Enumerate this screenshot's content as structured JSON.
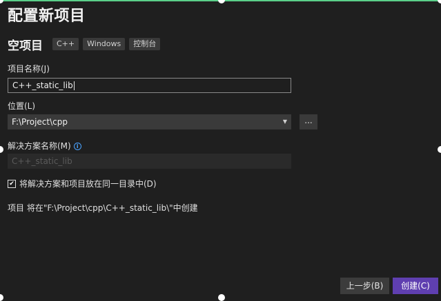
{
  "page": {
    "title": "配置新项目",
    "template_name": "空项目",
    "tags": [
      "C++",
      "Windows",
      "控制台"
    ]
  },
  "form": {
    "project_name_label": "项目名称(J)",
    "project_name_value": "C++_static_lib",
    "location_label": "位置(L)",
    "location_value": "F:\\Project\\cpp",
    "browse_label": "...",
    "solution_name_label": "解决方案名称(M)",
    "solution_name_value": "C++_static_lib",
    "same_dir_checkbox_label": "将解决方案和项目放在同一目录中(D)",
    "same_dir_checked": true,
    "summary": "项目 将在\"F:\\Project\\cpp\\C++_static_lib\\\"中创建"
  },
  "buttons": {
    "back": "上一步(B)",
    "create": "创建(C)"
  },
  "colors": {
    "background": "#1f1f1f",
    "accent": "#5f3fb0",
    "info": "#4aa3ff"
  },
  "icons": {
    "info": "info-icon",
    "dropdown": "chevron-down-icon",
    "checkbox": "checkmark-icon"
  }
}
